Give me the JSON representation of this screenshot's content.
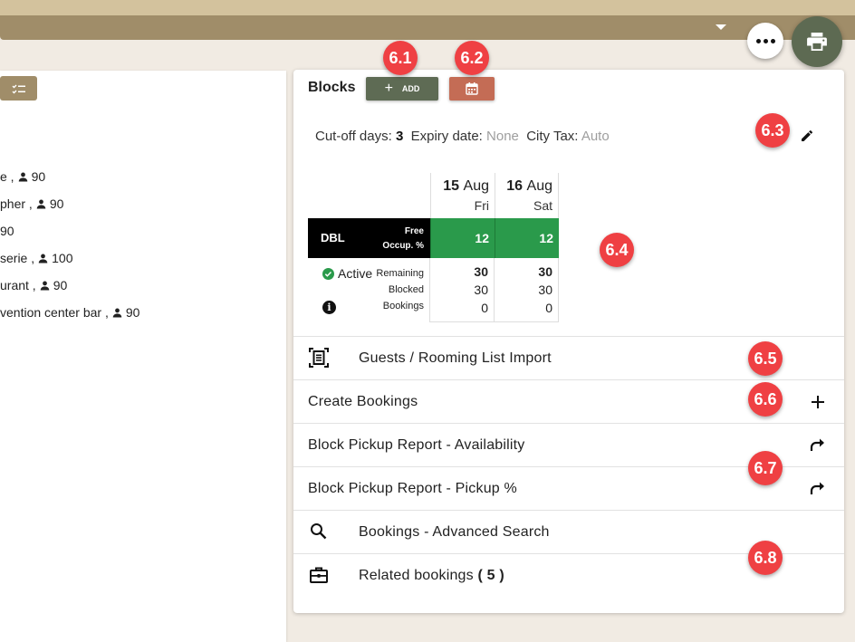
{
  "header": {
    "more_icon": "more-horiz-icon",
    "print_icon": "print-icon"
  },
  "left_panel": {
    "items": [
      {
        "label": "e ,",
        "capacity": "90"
      },
      {
        "label": "pher ,",
        "capacity": "90"
      },
      {
        "label": "90",
        "capacity": ""
      },
      {
        "label": "serie ,",
        "capacity": "100"
      },
      {
        "label": "urant ,",
        "capacity": "90"
      },
      {
        "label": "vention center bar ,",
        "capacity": "90"
      }
    ]
  },
  "blocks": {
    "title": "Blocks",
    "add_label": "ADD",
    "cutoff_label": "Cut-off days:",
    "cutoff_value": "3",
    "expiry_label": "Expiry date:",
    "expiry_value": "None",
    "citytax_label": "City Tax:",
    "citytax_value": "Auto",
    "dates": [
      {
        "day": "15",
        "month": "Aug",
        "weekday": "Fri"
      },
      {
        "day": "16",
        "month": "Aug",
        "weekday": "Sat"
      }
    ],
    "room_type": "DBL",
    "free_label": "Free",
    "occ_label": "Occup. %",
    "free_values": [
      "12",
      "12"
    ],
    "status": "Active",
    "row_labels": [
      "Remaining",
      "Blocked",
      "Bookings"
    ],
    "columns": [
      {
        "remaining": "30",
        "blocked": "30",
        "bookings": "0"
      },
      {
        "remaining": "30",
        "blocked": "30",
        "bookings": "0"
      }
    ],
    "colors": {
      "free_cell": "#2a9a4b",
      "add_button": "#5e6b54",
      "calendar_button": "#c46c55",
      "marker": "#ef4043"
    }
  },
  "actions": {
    "guests_import": "Guests / Rooming List Import",
    "create_bookings": "Create Bookings",
    "pickup_availability": "Block Pickup Report - Availability",
    "pickup_percent": "Block Pickup Report - Pickup %",
    "advanced_search": "Bookings - Advanced Search",
    "related_bookings": "Related bookings",
    "related_count": "( 5 )"
  },
  "markers": [
    "6.1",
    "6.2",
    "6.3",
    "6.4",
    "6.5",
    "6.6",
    "6.7",
    "6.8"
  ]
}
